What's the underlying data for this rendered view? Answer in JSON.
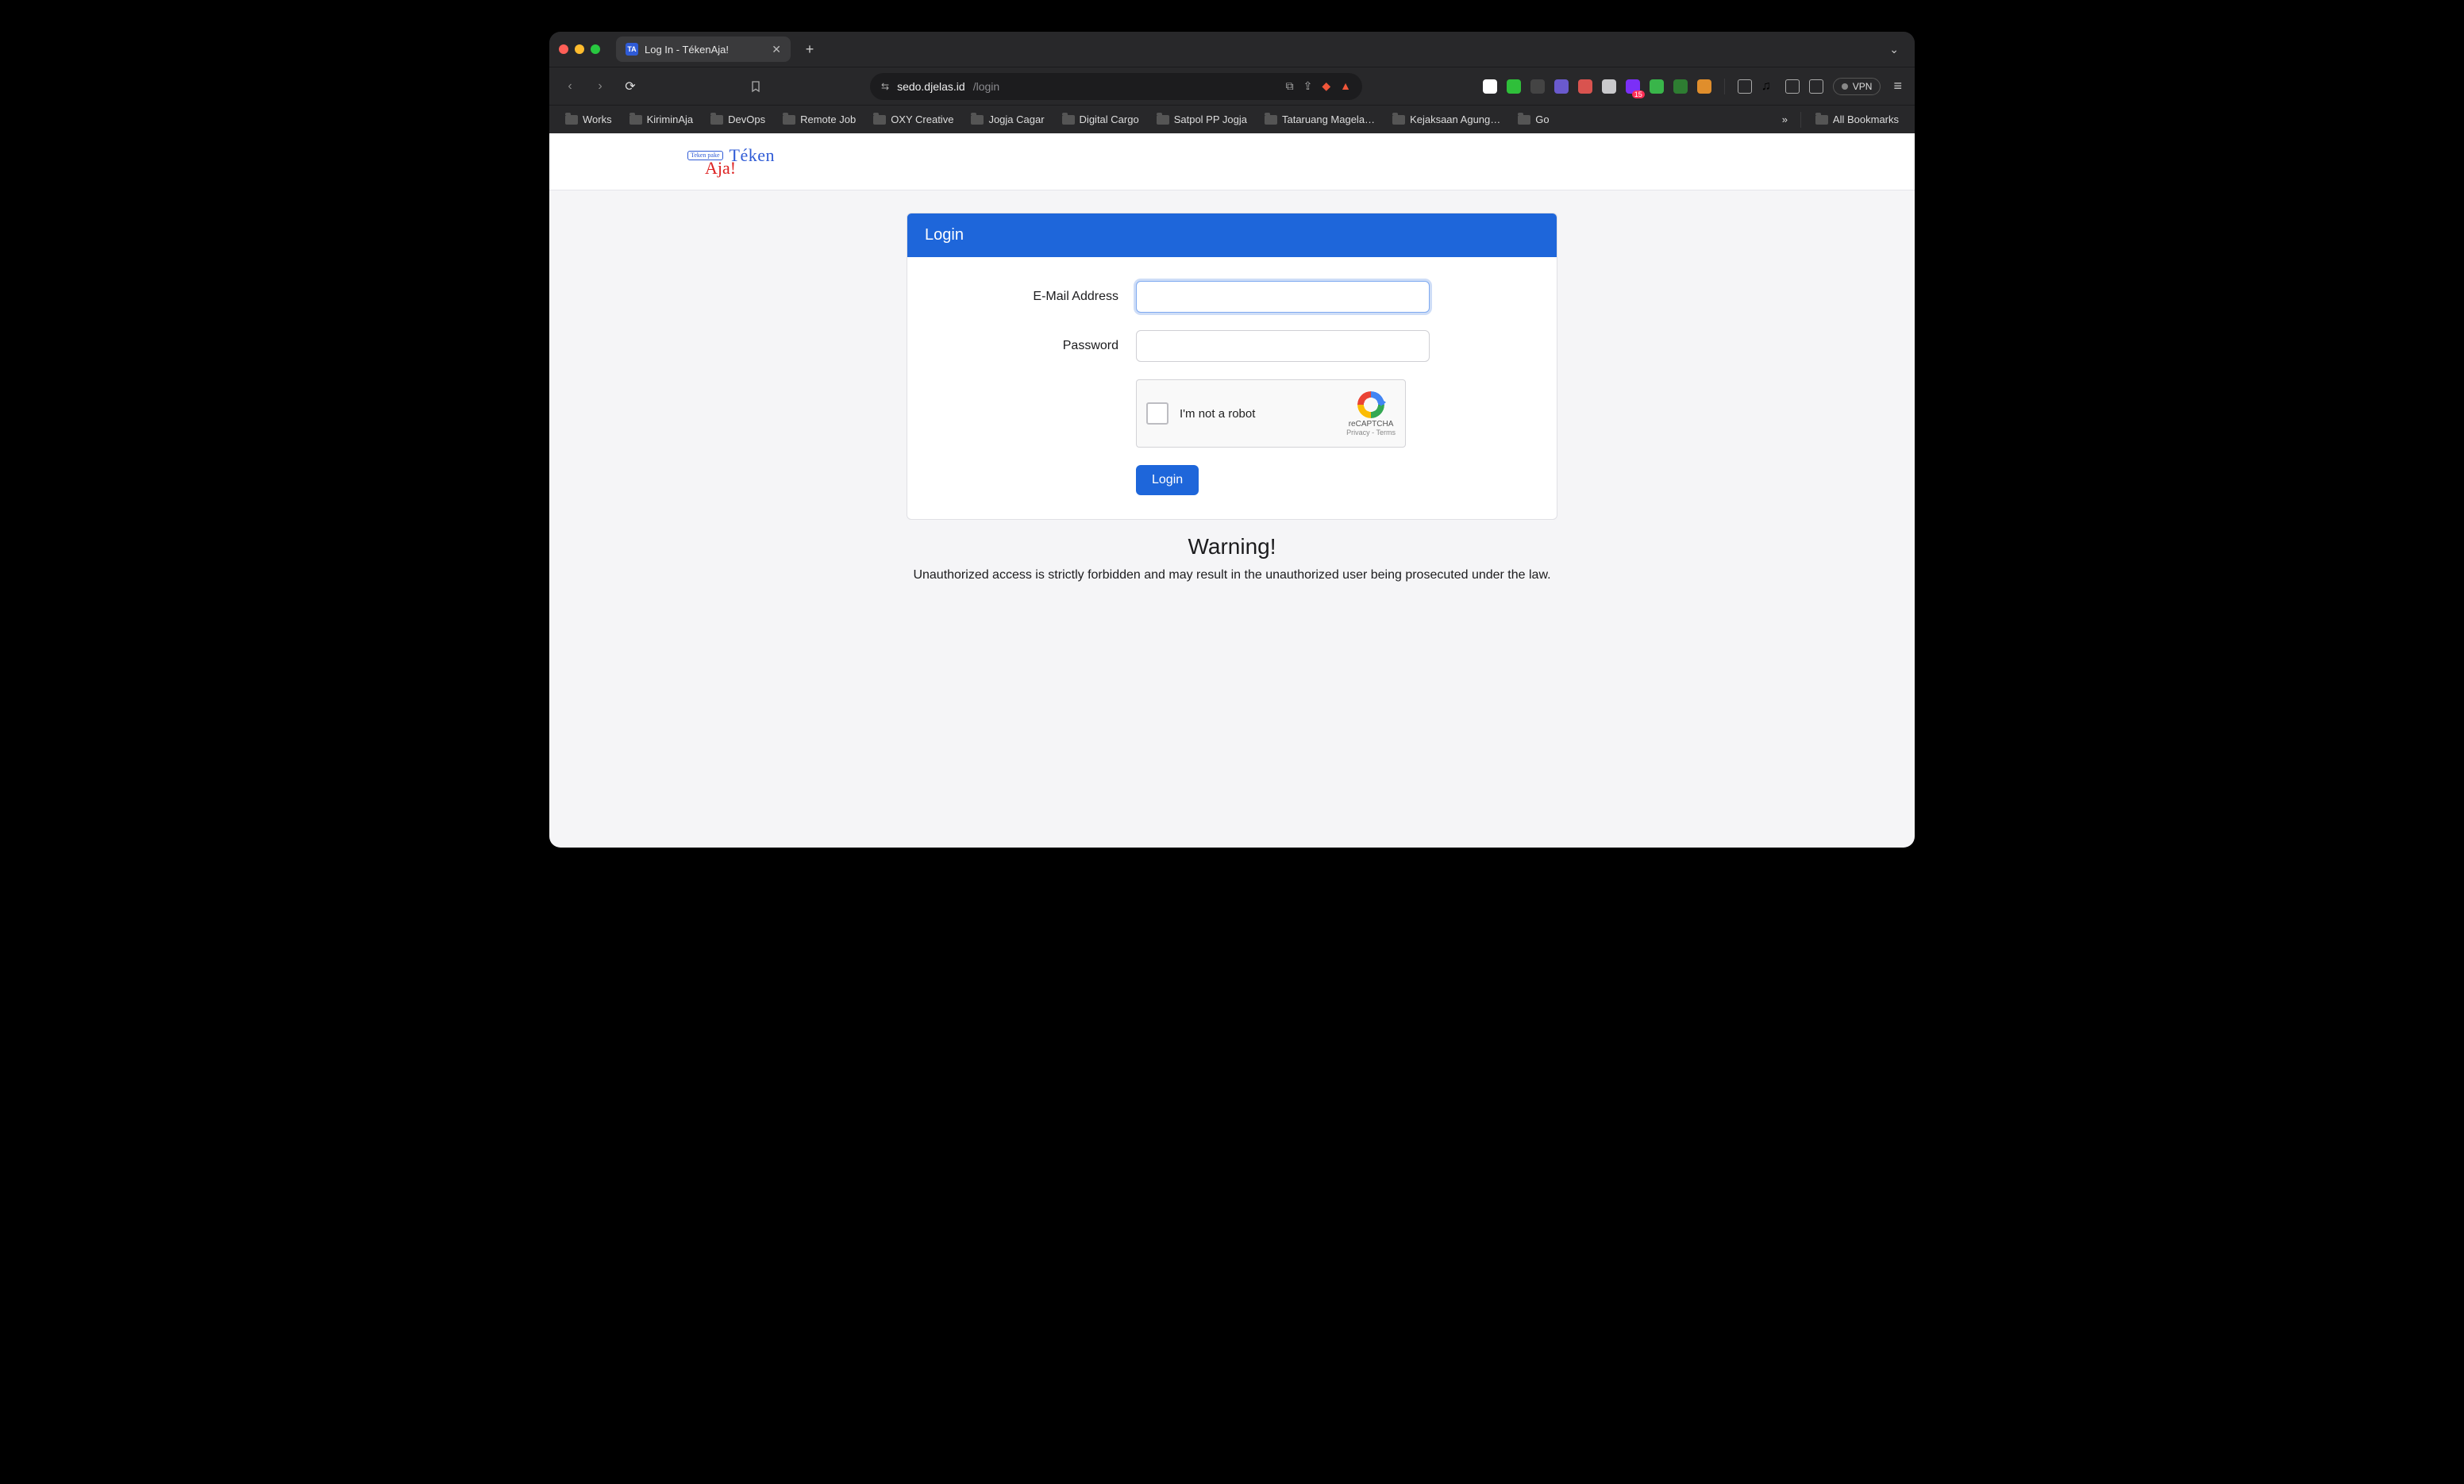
{
  "browser": {
    "tab_title": "Log In - TékenAja!",
    "tab_favicon_text": "TA",
    "url_host": "sedo.djelas.id",
    "url_path": "/login",
    "vpn_label": "VPN",
    "ext_badge": "15",
    "bookmarks": [
      "Works",
      "KiriminAja",
      "DevOps",
      "Remote Job",
      "OXY Creative",
      "Jogja Cagar",
      "Digital Cargo",
      "Satpol PP Jogja",
      "Tataruang Magela…",
      "Kejaksaan Agung…",
      "Go"
    ],
    "bookmarks_overflow": "»",
    "all_bookmarks": "All Bookmarks"
  },
  "logo": {
    "badge": "Teken pake",
    "line1": "Téken",
    "line2": "Aja!",
    "sub": ""
  },
  "card": {
    "title": "Login",
    "email_label": "E-Mail Address",
    "password_label": "Password",
    "login_button": "Login"
  },
  "captcha": {
    "text": "I'm not a robot",
    "brand": "reCAPTCHA",
    "legal_privacy": "Privacy",
    "legal_sep": " - ",
    "legal_terms": "Terms"
  },
  "warning": {
    "title": "Warning!",
    "body": "Unauthorized access is strictly forbidden and may result in the unauthorized user being prosecuted under the law."
  }
}
